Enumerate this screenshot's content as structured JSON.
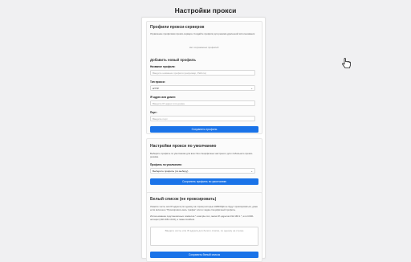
{
  "page": {
    "title": "Настройки прокси"
  },
  "profiles": {
    "title": "Профили прокси-серверов",
    "description": "Управление профилями прокси-сервера. Создайте профили для режима удаленной использования",
    "empty": "Нет сохранённых профилей",
    "add": {
      "title": "Добавить новый профиль",
      "name_label": "Название профиля:",
      "name_placeholder": "Введите название профиля (например, Работа)",
      "type_label": "Тип прокси:",
      "type_value": "HTTP",
      "host_label": "IP-адрес или домен:",
      "host_placeholder": "Введите IP-адрес или домен",
      "port_label": "Порт:",
      "port_placeholder": "Введите порт",
      "save_button": "Сохранить профиль"
    }
  },
  "default": {
    "title": "Настройки прокси по умолчанию",
    "description": "Выберите профиль по умолчанию для всех без специфичных настроек и для глобального прокси-режима.",
    "profile_label": "Профиль по умолчанию:",
    "profile_value": "Выберите профиль (по выбору)",
    "save_button": "Сохранить профиль по умолчанию"
  },
  "whitelist": {
    "title": "Белый список (не проксировать)",
    "description": "Укажите хосты или IP-адреса (по одному на строке) которые НИКОГДА не будут проксироваться, даже если включено \"Проксировать весь трафик\" или их задан специфичный профиль.",
    "hint": "Использование подстановочных символов *.example.com, маски IP-адресов 192.168.1.*, или CIDR-нотации (192.168.1.0/24), а также localhost.",
    "textarea_placeholder": "Введите хосты или IP-адреса для белого списка, по одному на строке",
    "save_button": "Сохранить белый список"
  },
  "icons": {
    "cursor": "hand-pointer-icon"
  }
}
